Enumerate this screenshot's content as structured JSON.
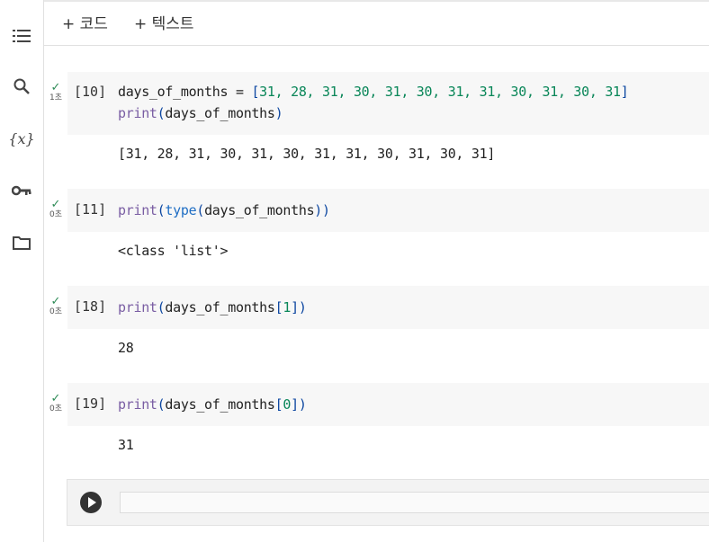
{
  "toolbar": {
    "add_code_label": "+ 코드",
    "add_text_label": "+ 텍스트"
  },
  "sidebar": {
    "items": [
      {
        "name": "toc-icon"
      },
      {
        "name": "search-icon"
      },
      {
        "name": "variables-icon",
        "label": "{x}"
      },
      {
        "name": "key-icon"
      },
      {
        "name": "folder-icon"
      }
    ]
  },
  "cells": [
    {
      "exec_count": "[10]",
      "status": "✓",
      "duration": "1초",
      "code_line1_name": "days_of_months",
      "code_line1_eq": " = ",
      "code_line1_values": "31, 28, 31, 30, 31, 30, 31, 31, 30, 31, 30, 31",
      "code_line2_fn": "print",
      "code_line2_arg": "days_of_months",
      "output": "[31, 28, 31, 30, 31, 30, 31, 31, 30, 31, 30, 31]"
    },
    {
      "exec_count": "[11]",
      "status": "✓",
      "duration": "0초",
      "code_fn": "print",
      "code_inner_fn": "type",
      "code_arg": "days_of_months",
      "output": "<class 'list'>"
    },
    {
      "exec_count": "[18]",
      "status": "✓",
      "duration": "0초",
      "code_fn": "print",
      "code_arg": "days_of_months",
      "code_index": "1",
      "output": "28"
    },
    {
      "exec_count": "[19]",
      "status": "✓",
      "duration": "0초",
      "code_fn": "print",
      "code_arg": "days_of_months",
      "code_index": "0",
      "output": "31"
    }
  ]
}
